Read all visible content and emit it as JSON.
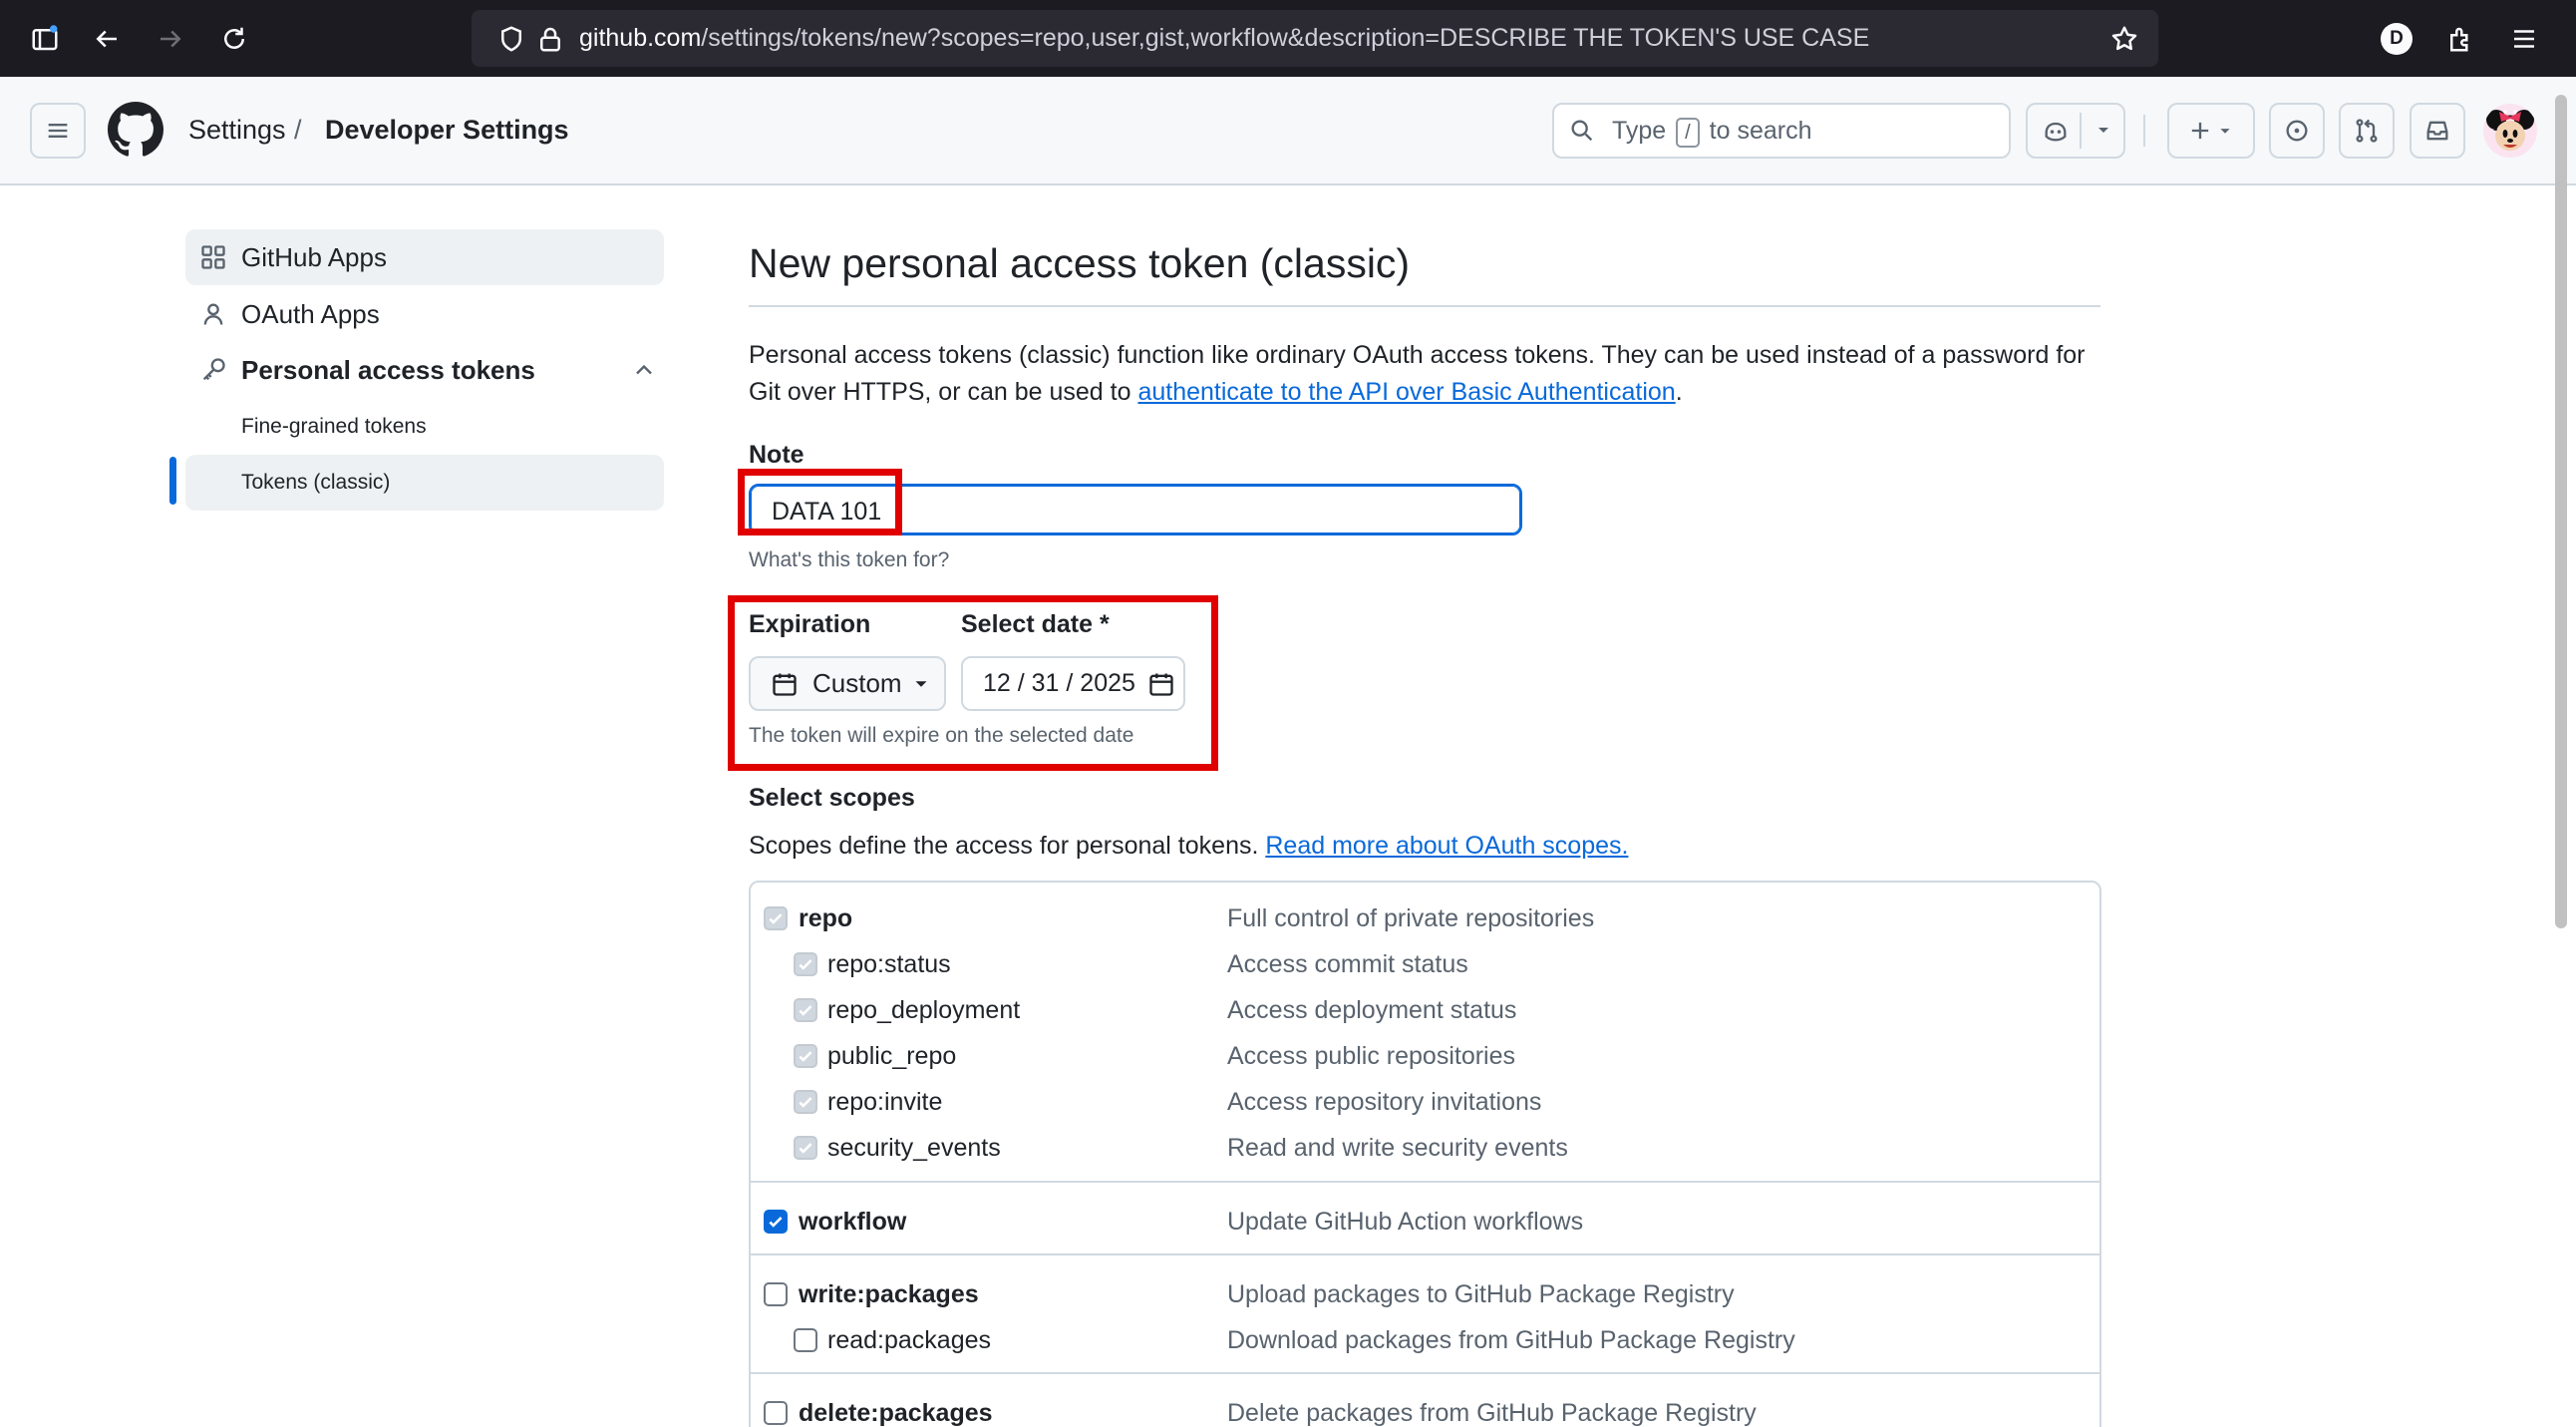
{
  "browser": {
    "url_host": "github.com",
    "url_path": "/settings/tokens/new?scopes=repo,user,gist,workflow&description=DESCRIBE THE TOKEN'S USE CASE",
    "profile_initial": "D"
  },
  "header": {
    "breadcrumb_settings": "Settings",
    "breadcrumb_separator": "/",
    "breadcrumb_developer": "Developer Settings",
    "search_type": "Type",
    "search_key": "/",
    "search_rest": "to search"
  },
  "sidebar": {
    "items": [
      {
        "label": "GitHub Apps"
      },
      {
        "label": "OAuth Apps"
      },
      {
        "label": "Personal access tokens"
      }
    ],
    "subitems": [
      {
        "label": "Fine-grained tokens"
      },
      {
        "label": "Tokens (classic)"
      }
    ]
  },
  "main": {
    "title": "New personal access token (classic)",
    "intro_text": "Personal access tokens (classic) function like ordinary OAuth access tokens. They can be used instead of a password for Git over HTTPS, or can be used to ",
    "intro_link": "authenticate to the API over Basic Authentication",
    "intro_end": ".",
    "note_label": "Note",
    "note_value": "DATA 101",
    "note_hint": "What's this token for?",
    "expiration_label": "Expiration",
    "expiration_value": "Custom",
    "date_label": "Select date *",
    "date_value": "12 / 31 / 2025",
    "expiration_hint": "The token will expire on the selected date",
    "scopes_label": "Select scopes",
    "scopes_text": "Scopes define the access for personal tokens. ",
    "scopes_link": "Read more about OAuth scopes."
  },
  "scopes": [
    {
      "name": "repo",
      "desc": "Full control of private repositories",
      "state": "disabled"
    },
    {
      "name": "repo:status",
      "desc": "Access commit status",
      "state": "disabled"
    },
    {
      "name": "repo_deployment",
      "desc": "Access deployment status",
      "state": "disabled"
    },
    {
      "name": "public_repo",
      "desc": "Access public repositories",
      "state": "disabled"
    },
    {
      "name": "repo:invite",
      "desc": "Access repository invitations",
      "state": "disabled"
    },
    {
      "name": "security_events",
      "desc": "Read and write security events",
      "state": "disabled"
    },
    {
      "name": "workflow",
      "desc": "Update GitHub Action workflows",
      "state": "checked"
    },
    {
      "name": "write:packages",
      "desc": "Upload packages to GitHub Package Registry",
      "state": "unchecked"
    },
    {
      "name": "read:packages",
      "desc": "Download packages from GitHub Package Registry",
      "state": "unchecked"
    },
    {
      "name": "delete:packages",
      "desc": "Delete packages from GitHub Package Registry",
      "state": "unchecked"
    }
  ],
  "colors": {
    "accent": "#0969da",
    "highlight_box": "#e00000",
    "browser_chrome": "#1c1b22"
  }
}
